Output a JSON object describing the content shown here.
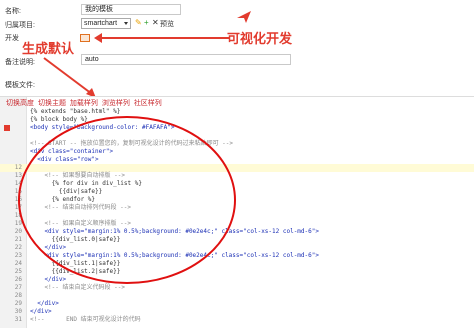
{
  "form": {
    "name_label": "名称:",
    "name_value": "我的模板",
    "project_label": "归属项目:",
    "project_value": "smartchart",
    "preview_label": "预览",
    "dev_label": "开发",
    "note_label": "备注说明:",
    "note_value": "auto",
    "template_label": "模板文件:"
  },
  "annotations": {
    "visual_dev": "可视化开发",
    "default_gen": "生成默认"
  },
  "tabs": [
    "切换高度",
    "切换主题",
    "加载样列",
    "浏览样列",
    "社区样列"
  ],
  "code_lines": [
    {
      "n": "",
      "t": "{% extends \"base.html\" %}"
    },
    {
      "n": "",
      "t": "{% block body %}"
    },
    {
      "n": "",
      "t": "<body style=\"background-color: #FAFAFA\">"
    },
    {
      "n": "",
      "t": ""
    },
    {
      "n": "",
      "t": "<!-- START -- 拖放位置您的，复制可视化设计的代码过来粘贴即可 -->"
    },
    {
      "n": "",
      "t": "<div class=\"container\">"
    },
    {
      "n": "",
      "t": "  <div class=\"row\">"
    },
    {
      "n": "12",
      "t": ""
    },
    {
      "n": "13",
      "t": "    <!-- 如果想要自动排版 -->"
    },
    {
      "n": "14",
      "t": "      {% for div in div_list %}"
    },
    {
      "n": "15",
      "t": "        {{div|safe}}"
    },
    {
      "n": "16",
      "t": "      {% endfor %}"
    },
    {
      "n": "17",
      "t": "    <!-- 结束自动排列代码段 -->"
    },
    {
      "n": "18",
      "t": ""
    },
    {
      "n": "19",
      "t": "    <!-- 如果自定义顺序排版 -->"
    },
    {
      "n": "20",
      "t": "    <div style=\"margin:1% 0.5%;background: #0e2e4c;\" class=\"col-xs-12 col-md-6\">"
    },
    {
      "n": "21",
      "t": "      {{div_list.0|safe}}"
    },
    {
      "n": "22",
      "t": "    </div>"
    },
    {
      "n": "23",
      "t": "    <div style=\"margin:1% 0.5%;background: #0e2e4c;\" class=\"col-xs-12 col-md-6\">"
    },
    {
      "n": "24",
      "t": "      {{div_list.1|safe}}"
    },
    {
      "n": "25",
      "t": "      {{div_list.2|safe}}"
    },
    {
      "n": "26",
      "t": "    </div>"
    },
    {
      "n": "27",
      "t": "    <!-- 结束自定义代码段 -->"
    },
    {
      "n": "28",
      "t": ""
    },
    {
      "n": "29",
      "t": "  </div>"
    },
    {
      "n": "30",
      "t": "</div>"
    },
    {
      "n": "31",
      "t": "<!--      END 结束可视化设计的代码"
    }
  ],
  "colors": {
    "accent_red": "#e23b2e",
    "ellipse": "#e01010"
  }
}
